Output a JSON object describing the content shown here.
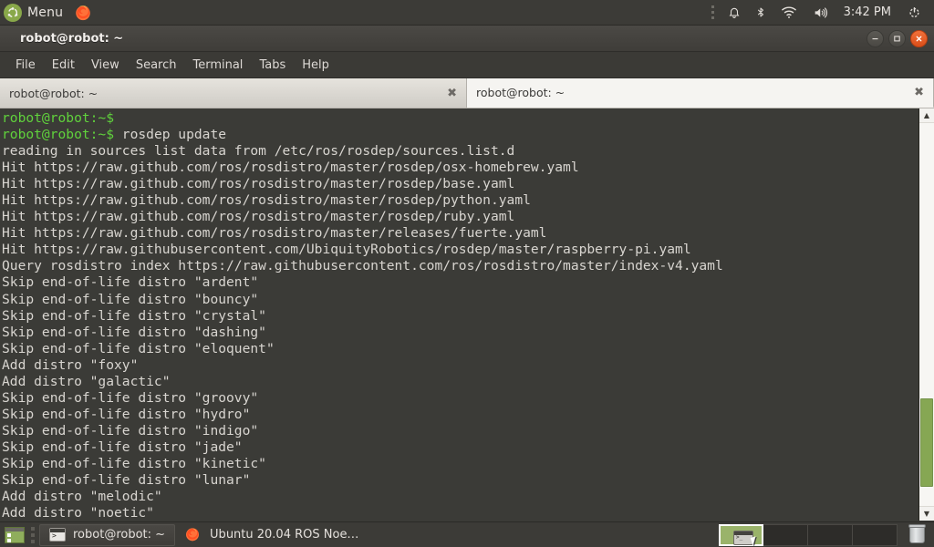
{
  "top_panel": {
    "menu_label": "Menu",
    "logo_icon": "ubuntu-logo-icon",
    "firefox_icon": "firefox-icon",
    "tray": {
      "grip_icon": "grip-dots-icon",
      "notification_icon": "bell-icon",
      "bluetooth_icon": "bluetooth-icon",
      "wifi_icon": "wifi-icon",
      "volume_icon": "volume-icon",
      "clock": "3:42 PM",
      "power_icon": "power-gear-icon"
    }
  },
  "window": {
    "title": "robot@robot: ~",
    "buttons": {
      "minimize": "—",
      "maximize": "□",
      "close": "×"
    },
    "menubar": [
      "File",
      "Edit",
      "View",
      "Search",
      "Terminal",
      "Tabs",
      "Help"
    ],
    "tabs": [
      {
        "label": "robot@robot: ~",
        "active": false,
        "close": "✖"
      },
      {
        "label": "robot@robot: ~",
        "active": true,
        "close": "✖"
      }
    ]
  },
  "terminal": {
    "prompt": "robot@robot:~$",
    "command": "rosdep update",
    "colors": {
      "prompt": "#60d23c",
      "text": "#d8d5d0",
      "background": "#3b3b37"
    },
    "lines": [
      {
        "type": "prompt",
        "prompt": "robot@robot:~$",
        "text": ""
      },
      {
        "type": "prompt",
        "prompt": "robot@robot:~$",
        "text": " rosdep update"
      },
      {
        "type": "out",
        "text": "reading in sources list data from /etc/ros/rosdep/sources.list.d"
      },
      {
        "type": "out",
        "text": "Hit https://raw.github.com/ros/rosdistro/master/rosdep/osx-homebrew.yaml"
      },
      {
        "type": "out",
        "text": "Hit https://raw.github.com/ros/rosdistro/master/rosdep/base.yaml"
      },
      {
        "type": "out",
        "text": "Hit https://raw.github.com/ros/rosdistro/master/rosdep/python.yaml"
      },
      {
        "type": "out",
        "text": "Hit https://raw.github.com/ros/rosdistro/master/rosdep/ruby.yaml"
      },
      {
        "type": "out",
        "text": "Hit https://raw.github.com/ros/rosdistro/master/releases/fuerte.yaml"
      },
      {
        "type": "out",
        "text": "Hit https://raw.githubusercontent.com/UbiquityRobotics/rosdep/master/raspberry-pi.yaml"
      },
      {
        "type": "out",
        "text": "Query rosdistro index https://raw.githubusercontent.com/ros/rosdistro/master/index-v4.yaml"
      },
      {
        "type": "out",
        "text": "Skip end-of-life distro \"ardent\""
      },
      {
        "type": "out",
        "text": "Skip end-of-life distro \"bouncy\""
      },
      {
        "type": "out",
        "text": "Skip end-of-life distro \"crystal\""
      },
      {
        "type": "out",
        "text": "Skip end-of-life distro \"dashing\""
      },
      {
        "type": "out",
        "text": "Skip end-of-life distro \"eloquent\""
      },
      {
        "type": "out",
        "text": "Add distro \"foxy\""
      },
      {
        "type": "out",
        "text": "Add distro \"galactic\""
      },
      {
        "type": "out",
        "text": "Skip end-of-life distro \"groovy\""
      },
      {
        "type": "out",
        "text": "Skip end-of-life distro \"hydro\""
      },
      {
        "type": "out",
        "text": "Skip end-of-life distro \"indigo\""
      },
      {
        "type": "out",
        "text": "Skip end-of-life distro \"jade\""
      },
      {
        "type": "out",
        "text": "Skip end-of-life distro \"kinetic\""
      },
      {
        "type": "out",
        "text": "Skip end-of-life distro \"lunar\""
      },
      {
        "type": "out",
        "text": "Add distro \"melodic\""
      },
      {
        "type": "out",
        "text": "Add distro \"noetic\""
      }
    ],
    "scrollbar": {
      "up_arrow": "▲",
      "down_arrow": "▼",
      "thumb_color": "#86a753"
    }
  },
  "bottom_panel": {
    "show_desktop_icon": "show-desktop-icon",
    "tasks": [
      {
        "label": "robot@robot: ~",
        "icon": "terminal-icon",
        "active": true
      },
      {
        "label": "Ubuntu 20.04 ROS Noe…",
        "icon": "firefox-icon",
        "active": false
      }
    ],
    "workspaces": [
      {
        "index": 1,
        "active": true
      },
      {
        "index": 2,
        "active": false
      },
      {
        "index": 3,
        "active": false
      },
      {
        "index": 4,
        "active": false
      }
    ],
    "trash_icon": "trash-icon"
  }
}
